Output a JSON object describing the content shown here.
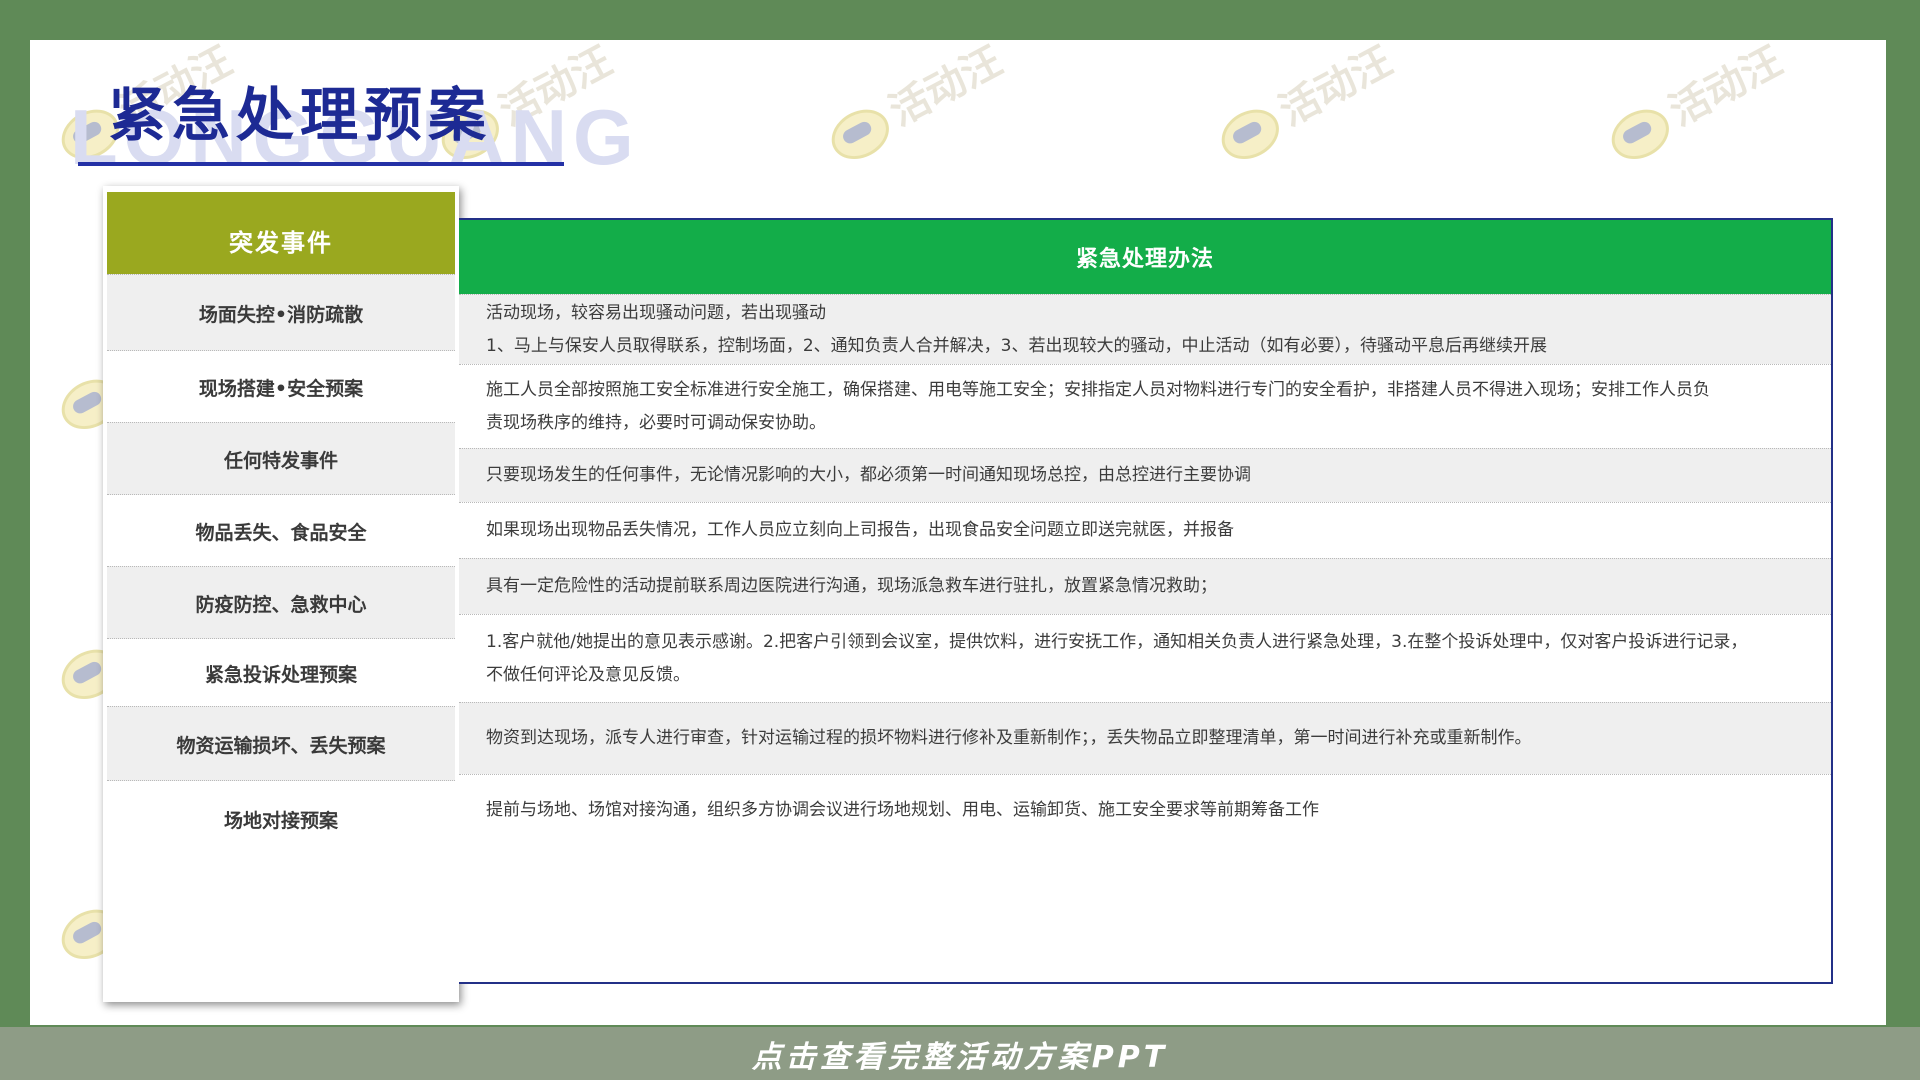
{
  "watermark": "活动汪",
  "ghost_text": "LONGGUANG",
  "title": "紧急处理预案",
  "left_header": "突发事件",
  "right_header": "紧急处理办法",
  "rows": [
    {
      "event": "场面失控•消防疏散",
      "lines": [
        "活动现场，较容易出现骚动问题，若出现骚动",
        "1、马上与保安人员取得联系，控制场面，2、通知负责人合并解决，3、若出现较大的骚动，中止活动（如有必要），待骚动平息后再继续开展"
      ]
    },
    {
      "event": "现场搭建•安全预案",
      "lines": [
        "施工人员全部按照施工安全标准进行安全施工，确保搭建、用电等施工安全；安排指定人员对物料进行专门的安全看护，非搭建人员不得进入现场；安排工作人员负",
        "责现场秩序的维持，必要时可调动保安协助。"
      ]
    },
    {
      "event": "任何特发事件",
      "lines": [
        "只要现场发生的任何事件，无论情况影响的大小，都必须第一时间通知现场总控，由总控进行主要协调"
      ]
    },
    {
      "event": "物品丢失、食品安全",
      "lines": [
        "如果现场出现物品丢失情况，工作人员应立刻向上司报告，出现食品安全问题立即送完就医，并报备"
      ]
    },
    {
      "event": "防疫防控、急救中心",
      "lines": [
        "具有一定危险性的活动提前联系周边医院进行沟通，现场派急救车进行驻扎，放置紧急情况救助；"
      ]
    },
    {
      "event": "紧急投诉处理预案",
      "lines": [
        "1.客户就他/她提出的意见表示感谢。2.把客户引领到会议室，提供饮料，进行安抚工作，通知相关负责人进行紧急处理，3.在整个投诉处理中，仅对客户投诉进行记录，",
        "不做任何评论及意见反馈。"
      ]
    },
    {
      "event": "物资运输损坏、丢失预案",
      "lines": [
        "物资到达现场，派专人进行审查，针对运输过程的损坏物料进行修补及重新制作；，丢失物品立即整理清单，第一时间进行补充或重新制作。"
      ]
    },
    {
      "event": "场地对接预案",
      "lines": [
        "提前与场地、场馆对接沟通，组织多方协调会议进行场地规划、用电、运输卸货、施工安全要求等前期筹备工作"
      ]
    }
  ],
  "footer_button": "点击查看完整活动方案PPT",
  "colors": {
    "background": "#5f8a57",
    "title": "#1d2a94",
    "left_header": "#9aa81f",
    "right_header": "#13ad49",
    "border": "#233087"
  }
}
